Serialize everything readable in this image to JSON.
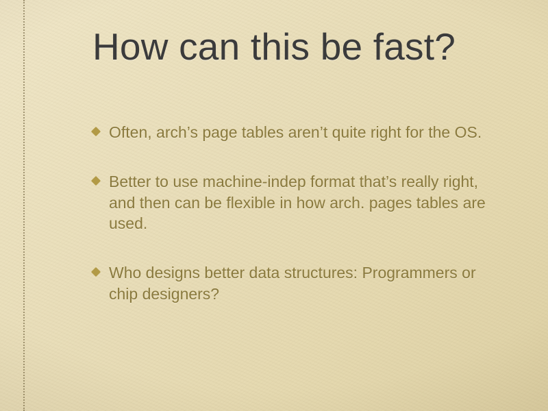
{
  "title": "How can this be fast?",
  "bullets": [
    "Often, arch’s page tables aren’t quite right for the OS.",
    "Better to use machine-indep format that’s really right, and then can be flexible in how arch. pages tables are used.",
    "Who designs better data structures: Programmers or chip designers?"
  ]
}
